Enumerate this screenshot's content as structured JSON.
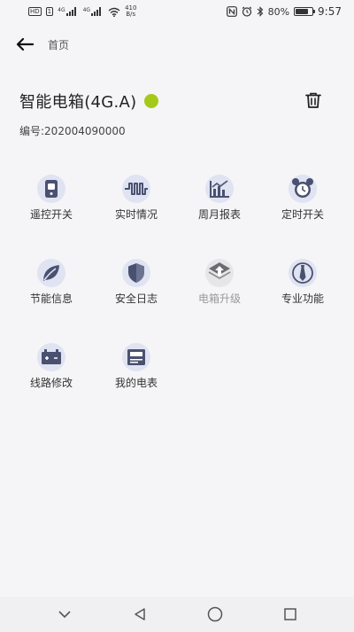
{
  "status_bar": {
    "hd_badge": "HD",
    "sim_badge": "1",
    "network_1": "4G",
    "network_2": "4G",
    "net_speed_value": "410",
    "net_speed_unit": "B/s",
    "battery_percent": "80%",
    "battery_level": 0.8,
    "time": "9:57",
    "icons": [
      "nfc-icon",
      "alarm-icon",
      "bluetooth-icon",
      "vibrate-icon"
    ]
  },
  "nav": {
    "title": "首页"
  },
  "device": {
    "name": "智能电箱(4G.A)",
    "status_color": "#a5c919",
    "id_text": "编号:202004090000"
  },
  "functions": [
    {
      "label": "遥控开关",
      "icon": "remote-switch-icon",
      "enabled": true
    },
    {
      "label": "实时情况",
      "icon": "realtime-wave-icon",
      "enabled": true
    },
    {
      "label": "周月报表",
      "icon": "report-chart-icon",
      "enabled": true
    },
    {
      "label": "定时开关",
      "icon": "alarm-clock-icon",
      "enabled": true
    },
    {
      "label": "节能信息",
      "icon": "leaf-icon",
      "enabled": true
    },
    {
      "label": "安全日志",
      "icon": "shield-icon",
      "enabled": true
    },
    {
      "label": "电箱升级",
      "icon": "upgrade-arrow-icon",
      "enabled": false
    },
    {
      "label": "专业功能",
      "icon": "tie-icon",
      "enabled": true
    },
    {
      "label": "线路修改",
      "icon": "battery-circuit-icon",
      "enabled": true
    },
    {
      "label": "我的电表",
      "icon": "meter-icon",
      "enabled": true
    }
  ],
  "colors": {
    "icon_bg": "#dfe3f2",
    "icon_fg": "#4a5170",
    "accent": "#a5c919"
  }
}
